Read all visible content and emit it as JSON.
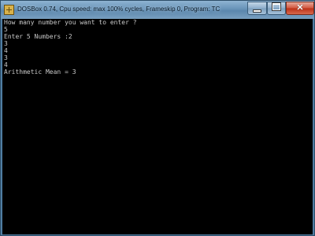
{
  "window": {
    "title": "DOSBox 0.74, Cpu speed: max 100% cycles, Frameskip  0, Program:     TC"
  },
  "controls": {
    "minimize_icon": "minimize-icon",
    "maximize_icon": "maximize-icon",
    "close_icon": "close-icon"
  },
  "console": {
    "lines": [
      "How many number you want to enter ?",
      "5",
      "Enter 5 Numbers :2",
      "3",
      "4",
      "3",
      "4",
      "Arithmetic Mean = 3"
    ]
  },
  "colors": {
    "console_bg": "#000000",
    "console_text": "#c9c9c9",
    "titlebar": "#6893b8",
    "close_button": "#c7432a"
  }
}
